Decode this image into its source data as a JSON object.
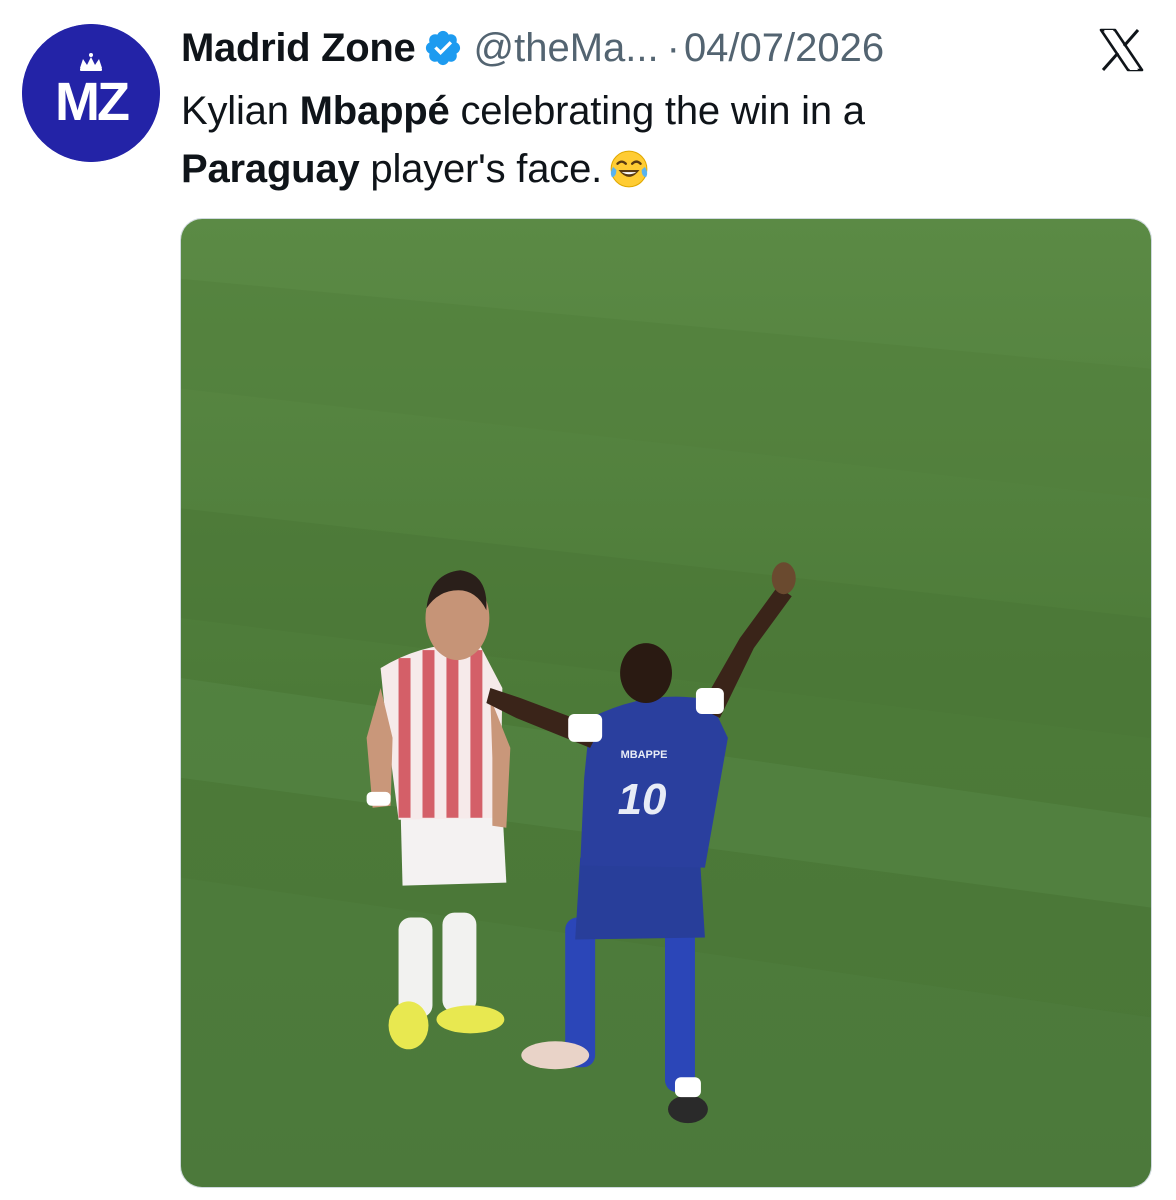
{
  "author": {
    "display_name": "Madrid Zone",
    "handle": "@theMa...",
    "separator": "·",
    "date": "04/07/2026",
    "avatar_text": "MZ",
    "verified_icon": "verified-badge-icon",
    "avatar_color": "#2323a7"
  },
  "tweet": {
    "text_1": "Kylian ",
    "bold_1": "Mbappé",
    "text_2": " celebrating the win in a ",
    "bold_2": "Paraguay",
    "text_3": " player's face.",
    "emoji": "face-with-tears-of-joy-icon"
  },
  "media": {
    "jersey_number": "10",
    "jersey_name": "MBAPPE"
  },
  "platform": {
    "logo": "x-logo-icon"
  },
  "colors": {
    "verified": "#1d9bf0",
    "text": "#0f1419",
    "muted": "#536471",
    "pitch": "#4f7a3a"
  }
}
